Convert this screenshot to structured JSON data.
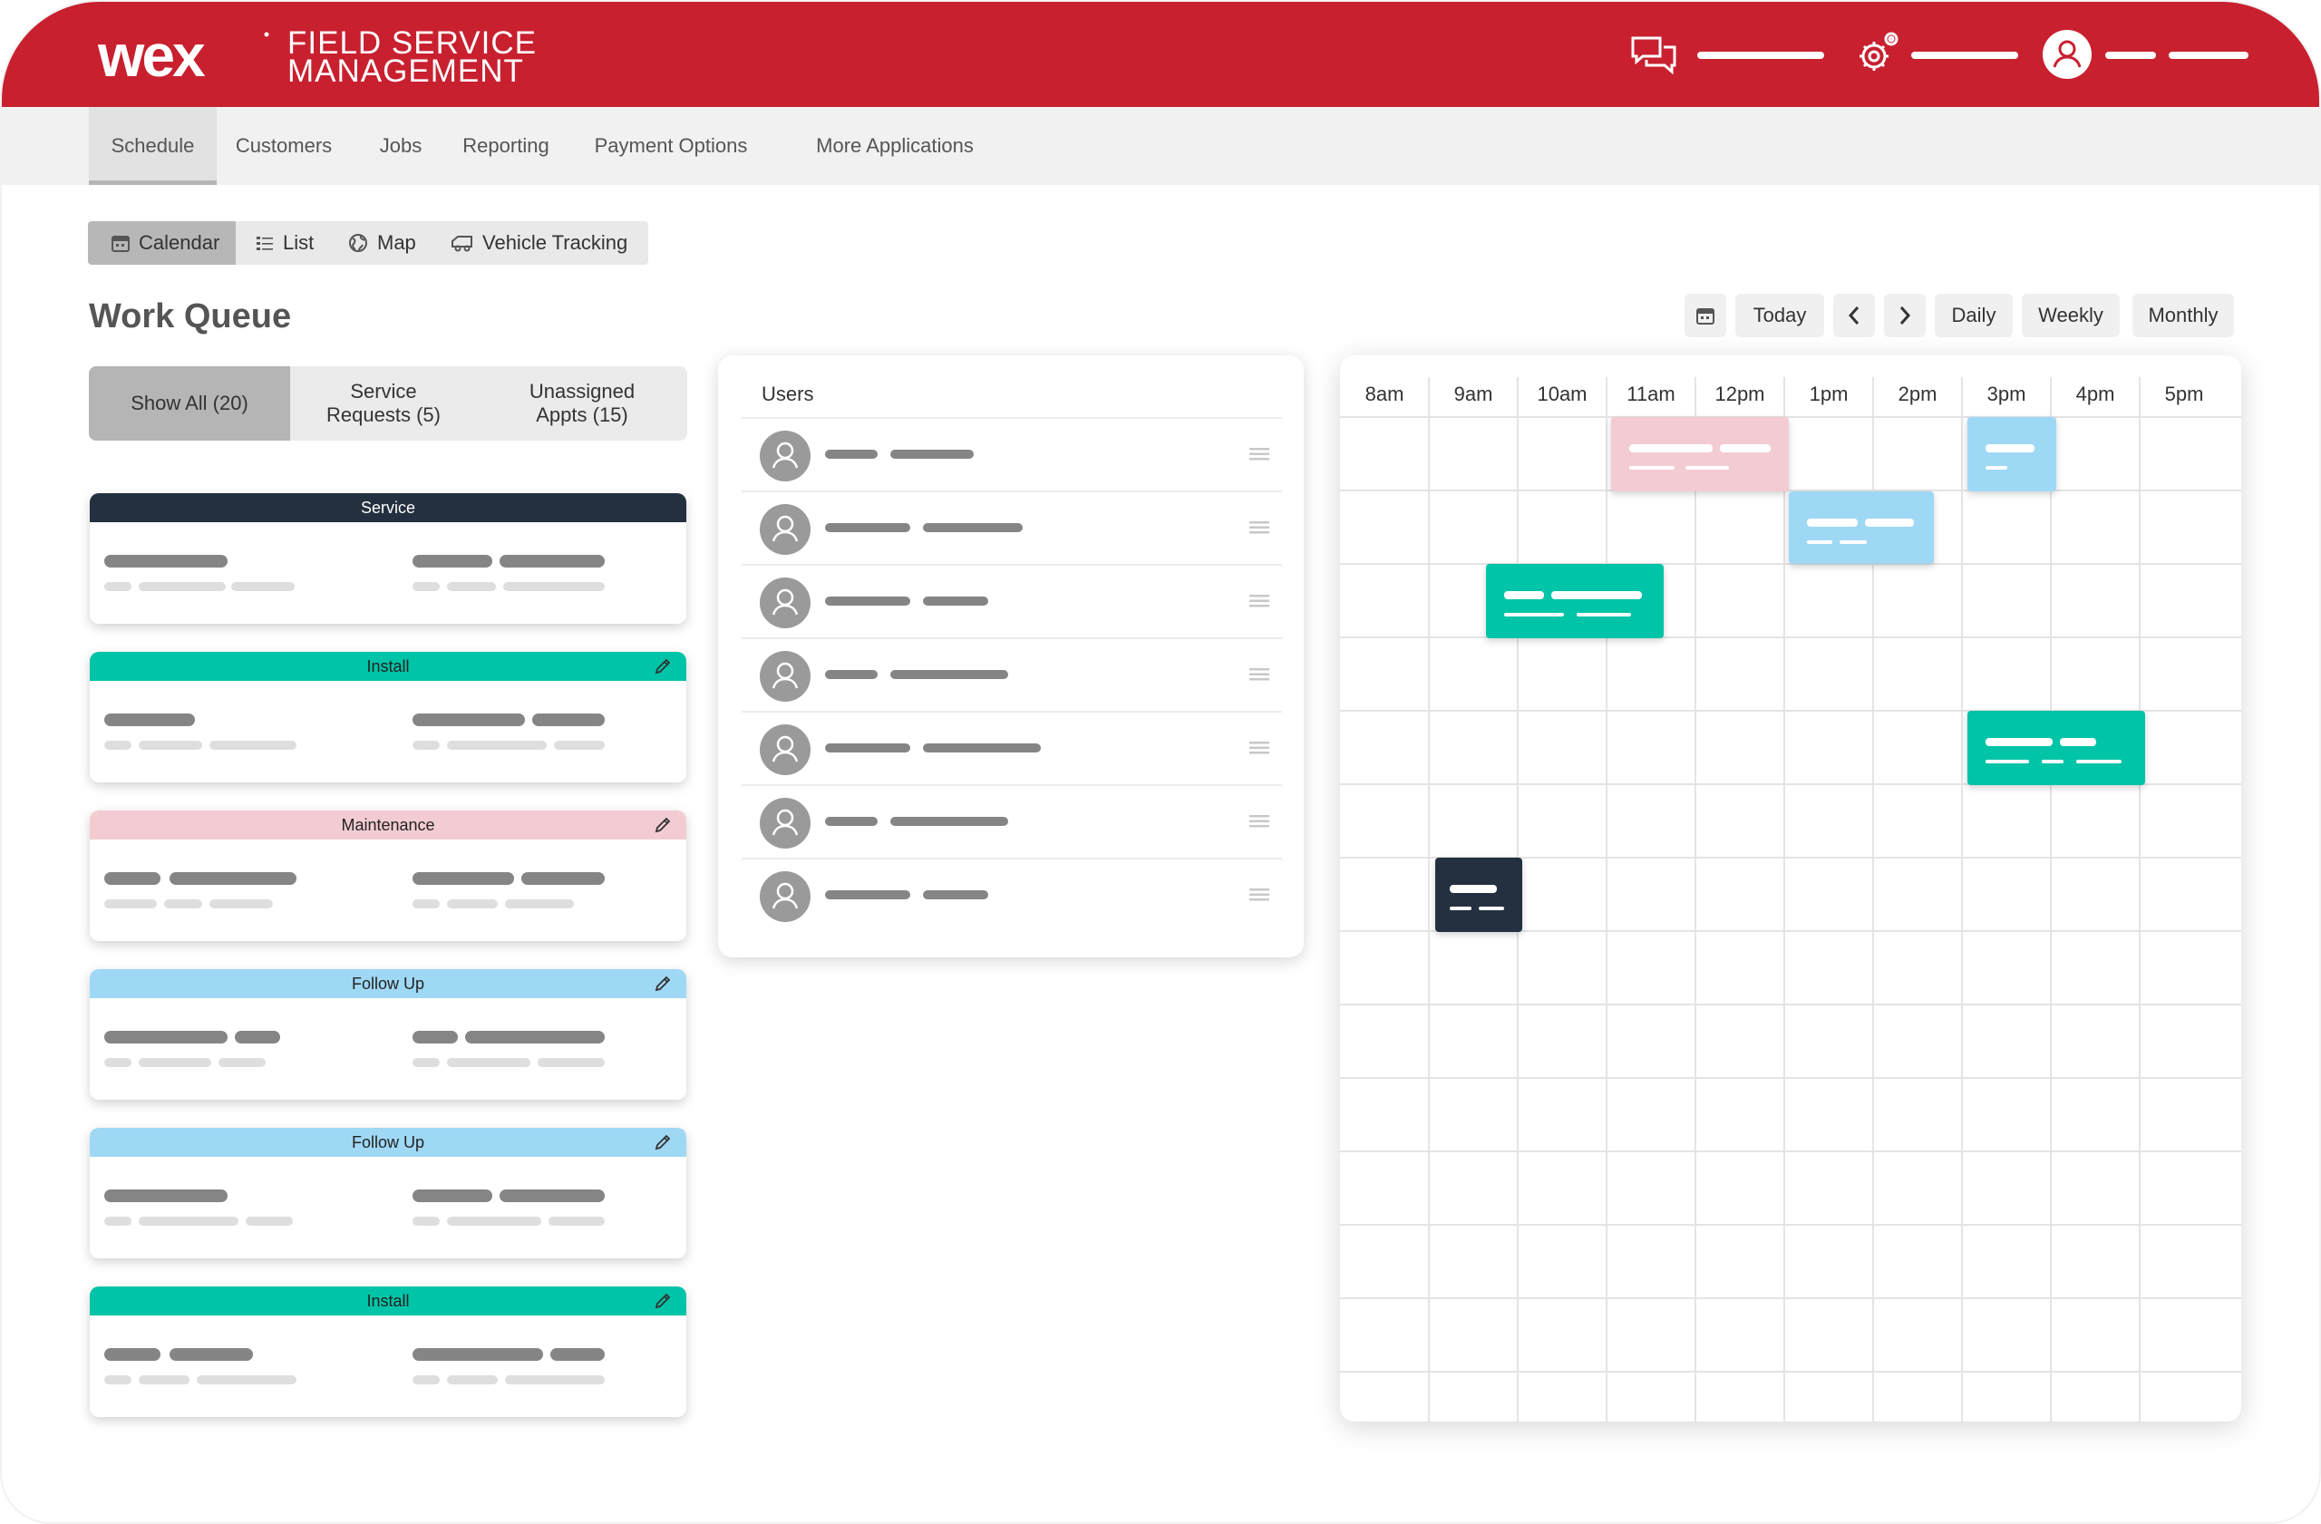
{
  "app": {
    "brand_line1": "FIELD SERVICE",
    "brand_line2": "MANAGEMENT",
    "colors": {
      "brand_red": "#c8202f",
      "service": "#24303f",
      "install": "#00c4a7",
      "maintenance": "#f3ccd3",
      "follow_up": "#9fd8f5"
    }
  },
  "header_icons": [
    "chat-icon",
    "settings-gear-icon",
    "user-avatar-icon"
  ],
  "nav": {
    "tabs": [
      "Schedule",
      "Customers",
      "Jobs",
      "Reporting",
      "Payment Options",
      "More Applications"
    ],
    "active": "Schedule"
  },
  "views": {
    "items": [
      "Calendar",
      "List",
      "Map",
      "Vehicle Tracking"
    ],
    "active": "Calendar"
  },
  "work_queue": {
    "title": "Work Queue",
    "filters": {
      "show_all": "Show All (20)",
      "service_requests_1": "Service",
      "service_requests_2": "Requests (5)",
      "unassigned_1": "Unassigned",
      "unassigned_2": "Appts (15)"
    },
    "cards": [
      {
        "type": "Service",
        "editable": false
      },
      {
        "type": "Install",
        "editable": true
      },
      {
        "type": "Maintenance",
        "editable": true
      },
      {
        "type": "Follow Up",
        "editable": true
      },
      {
        "type": "Follow Up",
        "editable": true
      },
      {
        "type": "Install",
        "editable": true
      }
    ]
  },
  "calendar_controls": {
    "today": "Today",
    "daily": "Daily",
    "weekly": "Weekly",
    "monthly": "Monthly"
  },
  "users": {
    "title": "Users",
    "rows": 7
  },
  "calendar": {
    "hours": [
      "8am",
      "9am",
      "10am",
      "11am",
      "12pm",
      "1pm",
      "2pm",
      "3pm",
      "4pm",
      "5pm"
    ]
  }
}
